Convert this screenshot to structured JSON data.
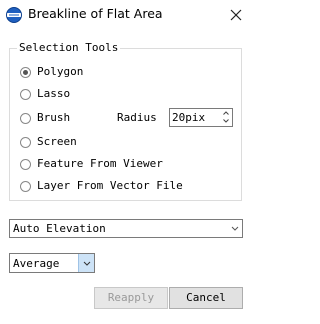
{
  "window": {
    "title": "Breakline of Flat Area",
    "app_icon": "globe-logo-icon",
    "close_icon": "close-icon"
  },
  "selection_tools": {
    "label": "Selection Tools",
    "options": [
      {
        "label": "Polygon",
        "checked": true
      },
      {
        "label": "Lasso",
        "checked": false
      },
      {
        "label": "Brush",
        "checked": false
      },
      {
        "label": "Screen",
        "checked": false
      },
      {
        "label": "Feature From Viewer",
        "checked": false
      },
      {
        "label": "Layer From Vector File",
        "checked": false
      }
    ],
    "radius_label": "Radius",
    "radius_value": "20pix"
  },
  "elevation_select": {
    "value": "Auto Elevation"
  },
  "method_select": {
    "value": "Average"
  },
  "buttons": {
    "reapply": "Reapply",
    "cancel": "Cancel"
  },
  "colors": {
    "accent": "#cde3f7",
    "disabled_text": "#9a9a9a",
    "border": "#7a7a7a"
  }
}
